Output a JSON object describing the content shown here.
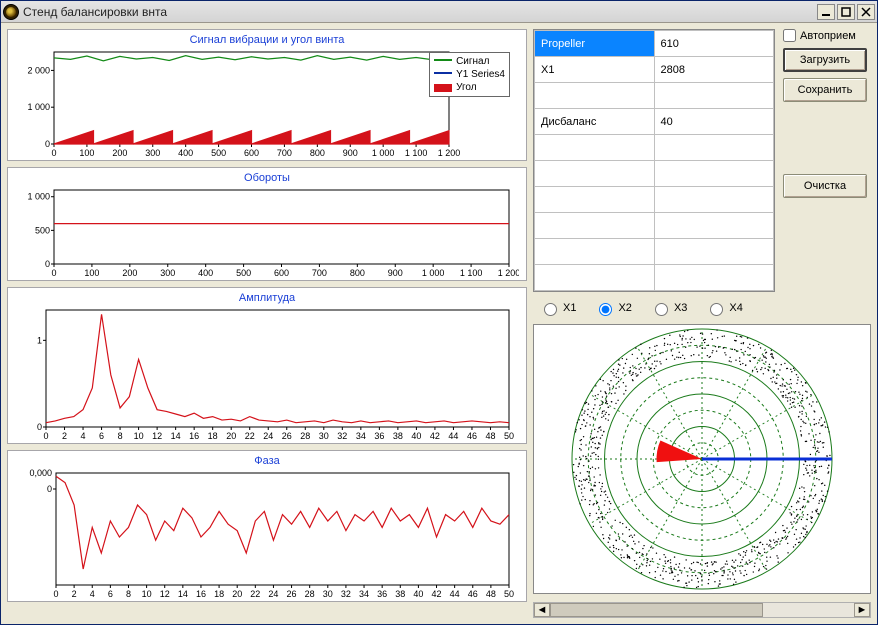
{
  "window": {
    "title": "Стенд балансировки внта"
  },
  "controls": {
    "autoreceive_label": "Автоприем",
    "load_label": "Загрузить",
    "save_label": "Сохранить",
    "clear_label": "Очистка"
  },
  "table": {
    "rows": [
      {
        "label": "Propeller",
        "value": "610",
        "active": true
      },
      {
        "label": "X1",
        "value": "2808"
      },
      {
        "label": "",
        "value": ""
      },
      {
        "label": "Дисбаланс",
        "value": "40"
      },
      {
        "label": "",
        "value": ""
      },
      {
        "label": "",
        "value": ""
      },
      {
        "label": "",
        "value": ""
      },
      {
        "label": "",
        "value": ""
      },
      {
        "label": "",
        "value": ""
      },
      {
        "label": "",
        "value": ""
      }
    ]
  },
  "radios": {
    "items": [
      "X1",
      "X2",
      "X3",
      "X4"
    ],
    "selected": 1
  },
  "chart_data": [
    {
      "id": "vibration",
      "type": "line",
      "title": "Сигнал вибрации и угол винта",
      "xlim": [
        0,
        1200
      ],
      "ylim": [
        0,
        2500
      ],
      "xticks": [
        0,
        100,
        200,
        300,
        400,
        500,
        600,
        700,
        800,
        900,
        1000,
        1100,
        1200
      ],
      "yticks": [
        0,
        1000,
        2000
      ],
      "yticklabels": [
        "0",
        "1 000",
        "2 000"
      ],
      "series": [
        {
          "name": "Сигнал",
          "color": "#138a17",
          "y": [
            2340,
            2300,
            2390,
            2260,
            2380,
            2310,
            2350,
            2270,
            2400,
            2300,
            2360,
            2290,
            2370,
            2310,
            2350,
            2280,
            2400,
            2300,
            2360,
            2280,
            2380,
            2300,
            2350,
            2290,
            2400
          ]
        },
        {
          "name": "Y1 Series4",
          "color": "#0b2fa3",
          "y": [
            0,
            0,
            0,
            0,
            0,
            0,
            0,
            0,
            0,
            0,
            0,
            0,
            0,
            0,
            0,
            0,
            0,
            0,
            0,
            0,
            0,
            0,
            0,
            0,
            0
          ]
        },
        {
          "name": "Угол",
          "color": "#d4121a",
          "fill": true,
          "pattern": "saw",
          "period": 120,
          "amp": 360
        }
      ],
      "legend": [
        "Сигнал",
        "Y1 Series4",
        "Угол"
      ]
    },
    {
      "id": "rpm",
      "type": "line",
      "title": "Обороты",
      "xlim": [
        0,
        1200
      ],
      "ylim": [
        0,
        1100
      ],
      "xticks": [
        0,
        100,
        200,
        300,
        400,
        500,
        600,
        700,
        800,
        900,
        1000,
        1100,
        1200
      ],
      "yticks": [
        0,
        500,
        1000
      ],
      "yticklabels": [
        "0",
        "500",
        "1 000"
      ],
      "series": [
        {
          "name": "rpm",
          "color": "#d4121a",
          "y": [
            600,
            600,
            600,
            600,
            600,
            600,
            600,
            600,
            600,
            600,
            600,
            600,
            600
          ]
        }
      ]
    },
    {
      "id": "amplitude",
      "type": "line",
      "title": "Амплитуда",
      "xlim": [
        0,
        50
      ],
      "ylim": [
        0,
        1.35
      ],
      "xticks": [
        0,
        2,
        4,
        6,
        8,
        10,
        12,
        14,
        16,
        18,
        20,
        22,
        24,
        26,
        28,
        30,
        32,
        34,
        36,
        38,
        40,
        42,
        44,
        46,
        48,
        50
      ],
      "yticks": [
        0,
        1
      ],
      "values": [
        0.05,
        0.07,
        0.1,
        0.12,
        0.2,
        0.45,
        1.3,
        0.6,
        0.22,
        0.35,
        0.78,
        0.45,
        0.2,
        0.18,
        0.15,
        0.12,
        0.16,
        0.1,
        0.12,
        0.08,
        0.09,
        0.07,
        0.12,
        0.08,
        0.07,
        0.06,
        0.08,
        0.05,
        0.06,
        0.07,
        0.05,
        0.08,
        0.06,
        0.05,
        0.07,
        0.05,
        0.06,
        0.07,
        0.05,
        0.06,
        0.07,
        0.05,
        0.06,
        0.07,
        0.05,
        0.06,
        0.07,
        0.06,
        0.05,
        0.06,
        0.05
      ],
      "color": "#d4121a"
    },
    {
      "id": "phase",
      "type": "line",
      "title": "Фаза",
      "xlim": [
        0,
        50
      ],
      "ylim": [
        -0.003,
        0.0005
      ],
      "xticks": [
        0,
        2,
        4,
        6,
        8,
        10,
        12,
        14,
        16,
        18,
        20,
        22,
        24,
        26,
        28,
        30,
        32,
        34,
        36,
        38,
        40,
        42,
        44,
        46,
        48,
        50
      ],
      "yticks": [
        0
      ],
      "yticklabels_extra": "0,000",
      "values": [
        0.0004,
        0.0002,
        -0.0005,
        -0.0025,
        -0.0012,
        -0.002,
        -0.001,
        -0.0015,
        -0.0012,
        -0.0005,
        -0.0008,
        -0.0016,
        -0.001,
        -0.0013,
        -0.0006,
        -0.0009,
        -0.0015,
        -0.0012,
        -0.0007,
        -0.0011,
        -0.0013,
        -0.002,
        -0.001,
        -0.0007,
        -0.0016,
        -0.0008,
        -0.0011,
        -0.0007,
        -0.0012,
        -0.0006,
        -0.001,
        -0.0007,
        -0.0013,
        -0.0008,
        -0.001,
        -0.0007,
        -0.0012,
        -0.0006,
        -0.001,
        -0.0008,
        -0.0012,
        -0.0006,
        -0.0015,
        -0.0008,
        -0.001,
        -0.0007,
        -0.0012,
        -0.0006,
        -0.001,
        -0.0011,
        -0.0008
      ],
      "color": "#d4121a"
    }
  ],
  "polar": {
    "rings": 8,
    "spokes": 12,
    "pointer_angle_deg": 0,
    "wedge_angle_deg": 190,
    "wedge_span_deg": 28,
    "color_pointer": "#0a2fd6",
    "color_wedge": "#f01010",
    "ring_color": "#1a7a1a"
  }
}
